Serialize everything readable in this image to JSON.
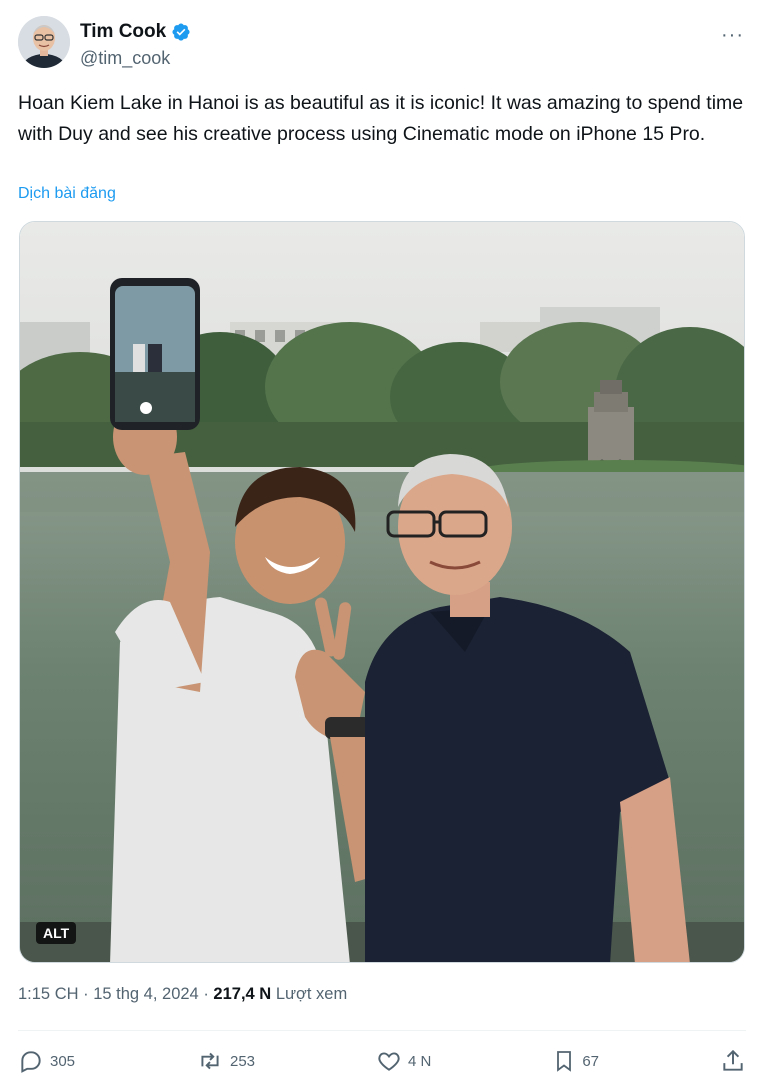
{
  "author": {
    "display_name": "Tim Cook",
    "handle": "@tim_cook",
    "verified_color": "#1d9bf0"
  },
  "tweet": {
    "text": "Hoan Kiem Lake in Hanoi is as beautiful as it is iconic! It was amazing to spend time with Duy and see his creative process using Cinematic mode on iPhone 15 Pro.",
    "translate_label": "Dịch bài đăng",
    "alt_label": "ALT"
  },
  "meta": {
    "time": "1:15 CH",
    "separator": "·",
    "date": "15 thg 4, 2024",
    "views_count": "217,4 N",
    "views_label": "Lượt xem"
  },
  "actions": {
    "replies": "305",
    "reposts": "253",
    "likes": "4 N",
    "bookmarks": "67"
  },
  "icons": {
    "more": "more-icon",
    "reply": "reply-icon",
    "repost": "repost-icon",
    "like": "like-icon",
    "bookmark": "bookmark-icon",
    "share": "share-icon",
    "verified": "verified-badge-icon"
  },
  "colors": {
    "accent": "#1d9bf0",
    "secondary_text": "#536471",
    "primary_text": "#0f1419"
  }
}
